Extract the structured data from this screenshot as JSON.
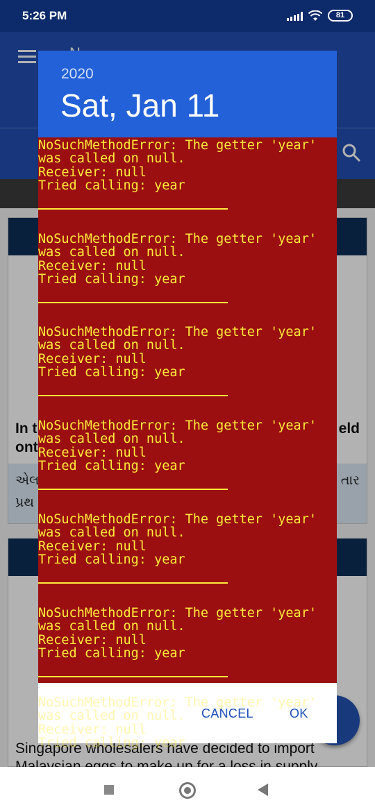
{
  "status_bar": {
    "time": "5:26 PM",
    "battery": "81",
    "signal_icon": "cellular-signal-icon",
    "wifi_icon": "wifi-icon",
    "battery_icon": "battery-icon"
  },
  "app_bar": {
    "title": "N",
    "menu_icon": "hamburger-menu-icon",
    "search_icon": "search-icon",
    "color": "#234eb0"
  },
  "feed": {
    "card1": {
      "headline_left_1": "In t",
      "headline_right_1": "eld",
      "headline_left_2": "ont",
      "gujarati_left_1": "એલ",
      "gujarati_right_1": "તાર",
      "gujarati_left_2": "પ્રથ"
    },
    "card2": {
      "story": "Singapore wholesalers have decided to import Malaysian eggs to make up for a loss in supply"
    }
  },
  "date_picker": {
    "year": "2020",
    "date": "Sat, Jan 11",
    "header_color": "#2361d8",
    "error_background": "#9b0f10",
    "error_text_color": "#ffeb3b",
    "errors": [
      {
        "line1": "NoSuchMethodError: The getter 'year'",
        "line2": "was called on null.",
        "line3": "Receiver: null",
        "line4": "Tried calling: year"
      },
      {
        "line1": "NoSuchMethodError: The getter 'year'",
        "line2": "was called on null.",
        "line3": "Receiver: null",
        "line4": "Tried calling: year"
      },
      {
        "line1": "NoSuchMethodError: The getter 'year'",
        "line2": "was called on null.",
        "line3": "Receiver: null",
        "line4": "Tried calling: year"
      },
      {
        "line1": "NoSuchMethodError: The getter 'year'",
        "line2": "was called on null.",
        "line3": "Receiver: null",
        "line4": "Tried calling: year"
      },
      {
        "line1": "NoSuchMethodError: The getter 'year'",
        "line2": "was called on null.",
        "line3": "Receiver: null",
        "line4": "Tried calling: year"
      },
      {
        "line1": "NoSuchMethodError: The getter 'year'",
        "line2": "was called on null.",
        "line3": "Receiver: null",
        "line4": "Tried calling: year"
      }
    ],
    "overflow_error": {
      "line1": "NoSuchMethodError: The getter 'year'",
      "line2": "was called on null.",
      "line3": "Receiver: null",
      "line4": "Tried calling: year"
    },
    "cancel_label": "CANCEL",
    "ok_label": "OK",
    "button_color": "#1d50b8"
  },
  "nav_bar": {
    "recents_icon": "square-recents-icon",
    "home_icon": "circle-home-icon",
    "back_icon": "triangle-back-icon"
  }
}
